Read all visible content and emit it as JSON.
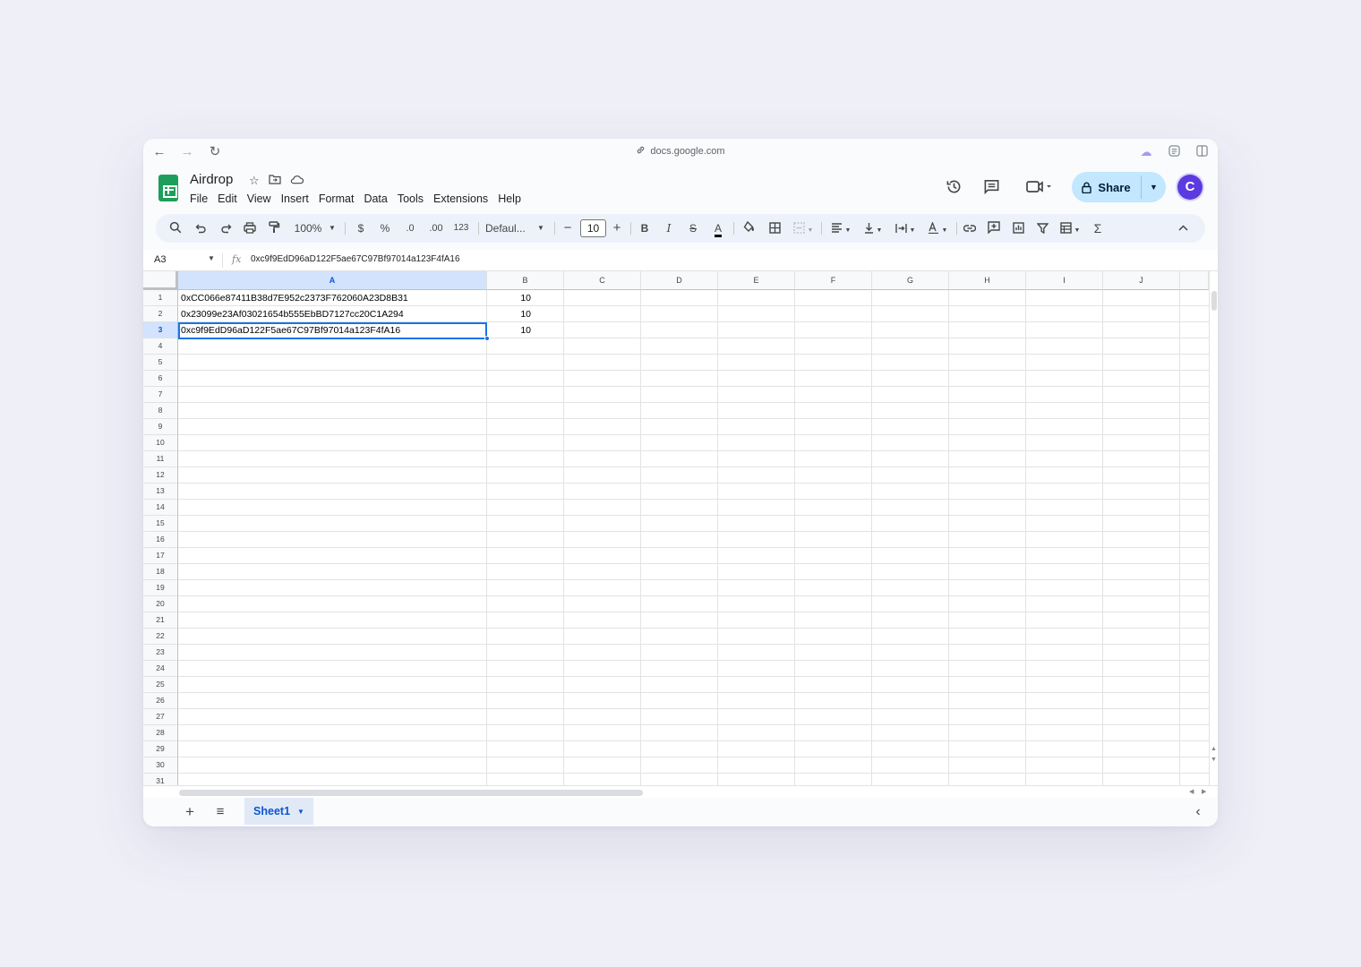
{
  "browser": {
    "url": "docs.google.com",
    "back_icon": "←",
    "forward_icon": "→",
    "reload_icon": "↻",
    "link_icon": "🔗"
  },
  "doc": {
    "title": "Airdrop",
    "menu": [
      "File",
      "Edit",
      "View",
      "Insert",
      "Format",
      "Data",
      "Tools",
      "Extensions",
      "Help"
    ]
  },
  "header": {
    "share_label": "Share",
    "avatar_letter": "C"
  },
  "toolbar": {
    "zoom": "100%",
    "currency": "$",
    "percent": "%",
    "decrease_decimal": ".0",
    "increase_decimal": ".00",
    "number_format": "123",
    "font": "Defaul...",
    "font_size": "10",
    "bold": "B",
    "italic": "I",
    "strikethrough": "S",
    "text_color": "A",
    "function": "Σ"
  },
  "formula_bar": {
    "name_box": "A3",
    "fx": "fx",
    "value": "0xc9f9EdD96aD122F5ae67C97Bf97014a123F4fA16"
  },
  "sheet": {
    "columns": [
      "A",
      "B",
      "C",
      "D",
      "E",
      "F",
      "G",
      "H",
      "I",
      "J"
    ],
    "selected_column": "A",
    "selected_row": 3,
    "row_count": 31,
    "rows": [
      {
        "a": "0xCC066e87411B38d7E952c2373F762060A23D8B31",
        "b": "10"
      },
      {
        "a": "0x23099e23Af03021654b555EbBD7127cc20C1A294",
        "b": "10"
      },
      {
        "a": "0xc9f9EdD96aD122F5ae67C97Bf97014a123F4fA16",
        "b": "10"
      }
    ]
  },
  "bottom": {
    "add_icon": "+",
    "list_icon": "≡",
    "sheet_tab": "Sheet1",
    "explore_icon": "‹"
  },
  "colors": {
    "selection": "#1a73e8",
    "header_selected": "#d3e3fd",
    "share_bg": "#c2e7ff",
    "logo": "#1e9e5a"
  }
}
